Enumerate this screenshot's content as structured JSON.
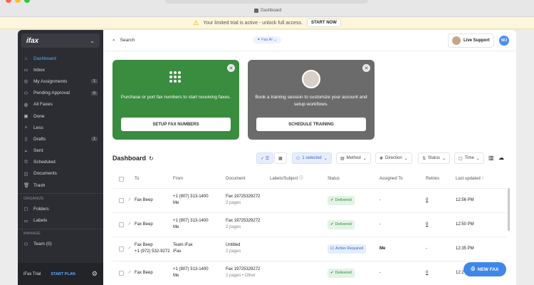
{
  "browser": {
    "tab_title": "Dashboard"
  },
  "banner": {
    "message": "Your limited trial is active - unlock full access.",
    "cta": "START NOW"
  },
  "sidebar": {
    "brand": "ifax",
    "items": [
      {
        "icon": "dashboard-icon",
        "glyph": "⌂",
        "label": "Dashboard",
        "active": true
      },
      {
        "icon": "inbox-icon",
        "glyph": "▭",
        "label": "Inbox"
      },
      {
        "icon": "assignments-icon",
        "glyph": "◎",
        "label": "My Assignments",
        "count": "1"
      },
      {
        "icon": "pending-icon",
        "glyph": "⚇",
        "label": "Pending Approval",
        "count": "0"
      },
      {
        "icon": "all-faxes-icon",
        "glyph": "◍",
        "label": "All Faxes"
      },
      {
        "icon": "done-icon",
        "glyph": "▣",
        "label": "Done"
      },
      {
        "icon": "less-icon",
        "glyph": "˄",
        "label": "Less"
      },
      {
        "icon": "drafts-icon",
        "glyph": "▯",
        "label": "Drafts",
        "count": "1"
      },
      {
        "icon": "sent-icon",
        "glyph": "➢",
        "label": "Sent"
      },
      {
        "icon": "scheduled-icon",
        "glyph": "⏲",
        "label": "Scheduled"
      },
      {
        "icon": "documents-icon",
        "glyph": "◫",
        "label": "Documents"
      },
      {
        "icon": "trash-icon",
        "glyph": "🗑",
        "label": "Trash"
      }
    ],
    "organize_label": "ORGANIZE",
    "organize": [
      {
        "icon": "folders-icon",
        "glyph": "▢",
        "label": "Folders"
      },
      {
        "icon": "labels-icon",
        "glyph": "▭",
        "label": "Labels"
      }
    ],
    "manage_label": "MANAGE",
    "manage": [
      {
        "icon": "team-icon",
        "glyph": "⚇",
        "label": "Team (0)"
      }
    ],
    "footer": {
      "trial": "iFax Trial",
      "cta": "START PLAN"
    }
  },
  "topbar": {
    "search": "Search",
    "fax_ai": "Fax AI",
    "support": "Live Support",
    "user_initials": "WJ"
  },
  "cards": [
    {
      "text": "Purchase or port fax numbers to start receiving faxes.",
      "button": "SETUP FAX NUMBERS"
    },
    {
      "text": "Book a training session to customize your account and setup workflows.",
      "button": "SCHEDULE TRAINING"
    }
  ],
  "dashboard": {
    "title": "Dashboard",
    "filters": {
      "selected": "1 selected",
      "method": "Method",
      "direction": "Direction",
      "status": "Status",
      "time": "Time"
    }
  },
  "table": {
    "columns": [
      "To",
      "From",
      "Document",
      "Labels/Subject",
      "Status",
      "Assigned To",
      "Retries",
      "Last updated"
    ],
    "rows": [
      {
        "to": "Fax Beep",
        "to2": "",
        "from": "+1 (907) 313-1400",
        "from2": "Me",
        "doc": "Fax 19725329272",
        "doc2": "2 pages",
        "status": "Delivered",
        "kind": "d",
        "assigned": "-",
        "retries": "0",
        "updated": "12:56 PM"
      },
      {
        "to": "Fax Beep",
        "to2": "",
        "from": "+1 (907) 313-1400",
        "from2": "Me",
        "doc": "Fax 19725329272",
        "doc2": "2 pages",
        "status": "Delivered",
        "kind": "d",
        "assigned": "-",
        "retries": "0",
        "updated": "12:50 PM"
      },
      {
        "to": "Fax Beep",
        "to2": "+1 (972) 532-9272",
        "from": "Team iFax",
        "from2": "iFax",
        "doc": "Untitled",
        "doc2": "2 pages",
        "status": "Action Required",
        "kind": "a",
        "assigned": "Me",
        "retries": "-",
        "updated": "12:35 PM"
      },
      {
        "to": "Fax Beep",
        "to2": "",
        "from": "+1 (907) 313-1400",
        "from2": "Me",
        "doc": "Fax 19725329272",
        "doc2": "2 pages • Other",
        "status": "Delivered",
        "kind": "d",
        "assigned": "-",
        "retries": "0",
        "updated": "12:2"
      }
    ]
  },
  "new_fax": "NEW FAX"
}
